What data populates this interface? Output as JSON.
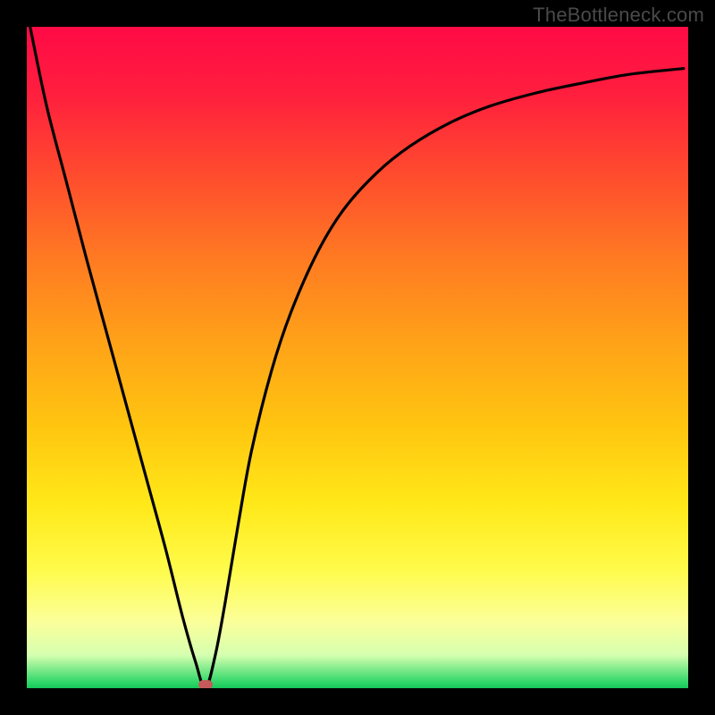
{
  "watermark": "TheBottleneck.com",
  "colors": {
    "frame": "#000000",
    "watermark": "#4a4a4a",
    "curve": "#000000",
    "marker": "#c65a5a",
    "gradient_top": "#ff0a46",
    "gradient_bottom": "#16c85a"
  },
  "chart_data": {
    "type": "line",
    "title": "",
    "xlabel": "",
    "ylabel": "",
    "xlim": [
      0,
      100
    ],
    "ylim": [
      0,
      100
    ],
    "grid": false,
    "note": "V-shaped bottleneck-style curve on rainbow heatmap gradient. Values estimated from pixels.",
    "series": [
      {
        "name": "curve",
        "x": [
          0.5,
          3,
          6,
          9,
          12,
          15,
          18,
          21,
          23.5,
          25.5,
          27,
          28.5,
          30,
          32,
          34,
          37,
          40,
          44,
          48,
          53,
          58,
          64,
          70,
          77,
          84,
          91,
          99.3
        ],
        "y": [
          100,
          88,
          76.5,
          65,
          54,
          43,
          32,
          21,
          11,
          4,
          0,
          5,
          13,
          25,
          36,
          48,
          57,
          66,
          72.5,
          78,
          82,
          85.5,
          88,
          90,
          91.5,
          92.8,
          93.7
        ]
      }
    ],
    "marker": {
      "x": 27.0,
      "y": 0.5,
      "shape": "rounded-rect"
    },
    "background_gradient": {
      "stops": [
        {
          "pos": 0,
          "color": "#ff0a46"
        },
        {
          "pos": 10,
          "color": "#ff1e3e"
        },
        {
          "pos": 22,
          "color": "#ff4a2e"
        },
        {
          "pos": 35,
          "color": "#ff7a22"
        },
        {
          "pos": 48,
          "color": "#ffa318"
        },
        {
          "pos": 60,
          "color": "#ffc410"
        },
        {
          "pos": 72,
          "color": "#ffe818"
        },
        {
          "pos": 82,
          "color": "#fffb4a"
        },
        {
          "pos": 90,
          "color": "#fbff9a"
        },
        {
          "pos": 95,
          "color": "#d6ffb0"
        },
        {
          "pos": 99,
          "color": "#34d86a"
        },
        {
          "pos": 100,
          "color": "#16c85a"
        }
      ]
    }
  }
}
